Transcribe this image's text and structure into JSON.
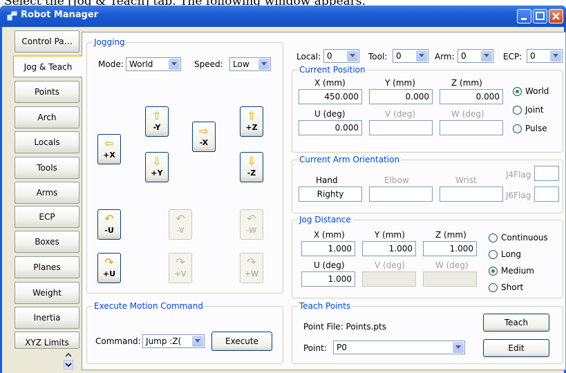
{
  "doc_text": "Select the [Jog & Teach] tab. The following window appears.",
  "window": {
    "title": "Robot Manager"
  },
  "tabs": [
    {
      "label": "Control Pa…",
      "active": false
    },
    {
      "label": "Jog & Teach",
      "active": true
    },
    {
      "label": "Points",
      "active": false
    },
    {
      "label": "Arch",
      "active": false
    },
    {
      "label": "Locals",
      "active": false
    },
    {
      "label": "Tools",
      "active": false
    },
    {
      "label": "Arms",
      "active": false
    },
    {
      "label": "ECP",
      "active": false
    },
    {
      "label": "Boxes",
      "active": false
    },
    {
      "label": "Planes",
      "active": false
    },
    {
      "label": "Weight",
      "active": false
    },
    {
      "label": "Inertia",
      "active": false
    },
    {
      "label": "XYZ Limits",
      "active": false
    }
  ],
  "jogging": {
    "title": "Jogging",
    "mode_label": "Mode:",
    "mode_value": "World",
    "speed_label": "Speed:",
    "speed_value": "Low",
    "buttons": {
      "plus_x": "+X",
      "minus_y": "-Y",
      "minus_x": "-X",
      "plus_z": "+Z",
      "plus_y": "+Y",
      "minus_z": "-Z",
      "minus_u": "-U",
      "minus_v": "-V",
      "minus_w": "-W",
      "plus_u": "+U",
      "plus_v": "+V",
      "plus_w": "+W"
    }
  },
  "top_selectors": {
    "local_label": "Local:",
    "local_value": "0",
    "tool_label": "Tool:",
    "tool_value": "0",
    "arm_label": "Arm:",
    "arm_value": "0",
    "ecp_label": "ECP:",
    "ecp_value": "0"
  },
  "current_position": {
    "title": "Current Position",
    "x_label": "X (mm)",
    "y_label": "Y (mm)",
    "z_label": "Z (mm)",
    "x": "450.000",
    "y": "0.000",
    "z": "0.000",
    "u_label": "U (deg)",
    "v_label": "V (deg)",
    "w_label": "W (deg)",
    "u": "0.000",
    "v": "",
    "w": "",
    "radios": {
      "world": "World",
      "joint": "Joint",
      "pulse": "Pulse",
      "selected": "world"
    }
  },
  "arm_orientation": {
    "title": "Current Arm Orientation",
    "hand_label": "Hand",
    "elbow_label": "Elbow",
    "wrist_label": "Wrist",
    "hand": "Righty",
    "elbow": "",
    "wrist": "",
    "j4flag_label": "J4Flag",
    "j6flag_label": "J6Flag"
  },
  "jog_distance": {
    "title": "Jog Distance",
    "x_label": "X (mm)",
    "y_label": "Y (mm)",
    "z_label": "Z (mm)",
    "x": "1.000",
    "y": "1.000",
    "z": "1.000",
    "u_label": "U (deg)",
    "v_label": "V (deg)",
    "w_label": "W (deg)",
    "u": "1.000",
    "radios": {
      "continuous": "Continuous",
      "long": "Long",
      "medium": "Medium",
      "short": "Short",
      "selected": "medium"
    }
  },
  "execute": {
    "title": "Execute Motion Command",
    "command_label": "Command:",
    "command_value": "Jump :Z(",
    "execute_label": "Execute"
  },
  "teach": {
    "title": "Teach Points",
    "point_file": "Point File: Points.pts",
    "point_label": "Point:",
    "point_value": "P0",
    "teach_label": "Teach",
    "edit_label": "Edit"
  }
}
